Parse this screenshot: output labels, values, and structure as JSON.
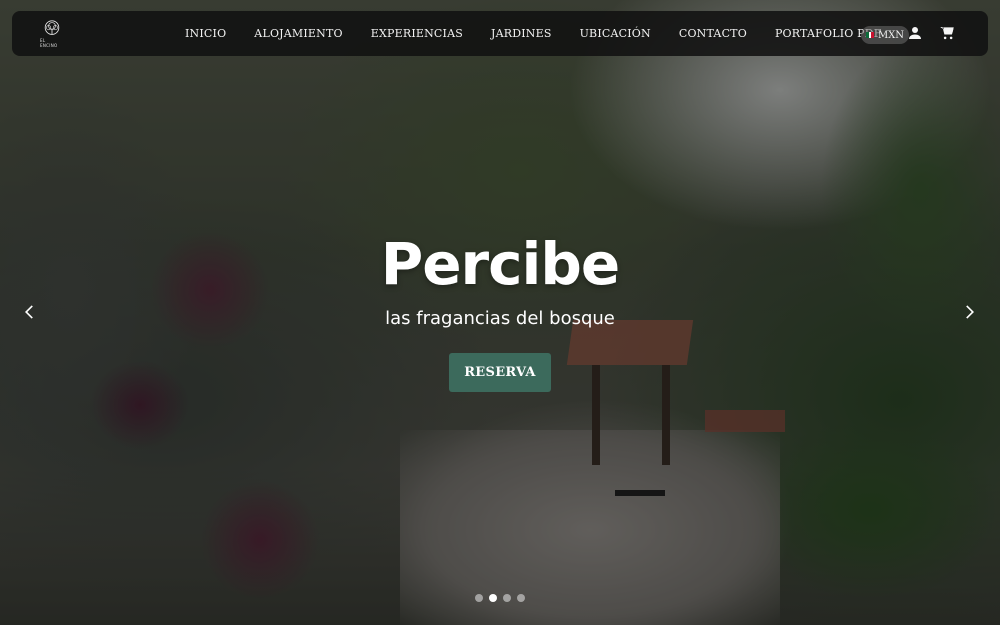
{
  "brand": {
    "logo_text": "EL ENCINO"
  },
  "nav": {
    "items": [
      {
        "label": "INICIO"
      },
      {
        "label": "ALOJAMIENTO"
      },
      {
        "label": "EXPERIENCIAS"
      },
      {
        "label": "JARDINES"
      },
      {
        "label": "UBICACIÓN"
      },
      {
        "label": "CONTACTO"
      },
      {
        "label": "PORTAFOLIO PDF"
      }
    ],
    "currency": "MXN",
    "icons": [
      "user-icon",
      "cart-icon"
    ]
  },
  "hero": {
    "title": "Percibe",
    "subtitle": "las fragancias del bosque",
    "cta_label": "RESERVA",
    "cta_color": "#3c6a5c",
    "slides_count": 4,
    "active_slide": 2
  },
  "colors": {
    "navbar_bg": "#111111",
    "accent": "#3c6a5c",
    "text": "#ffffff"
  }
}
